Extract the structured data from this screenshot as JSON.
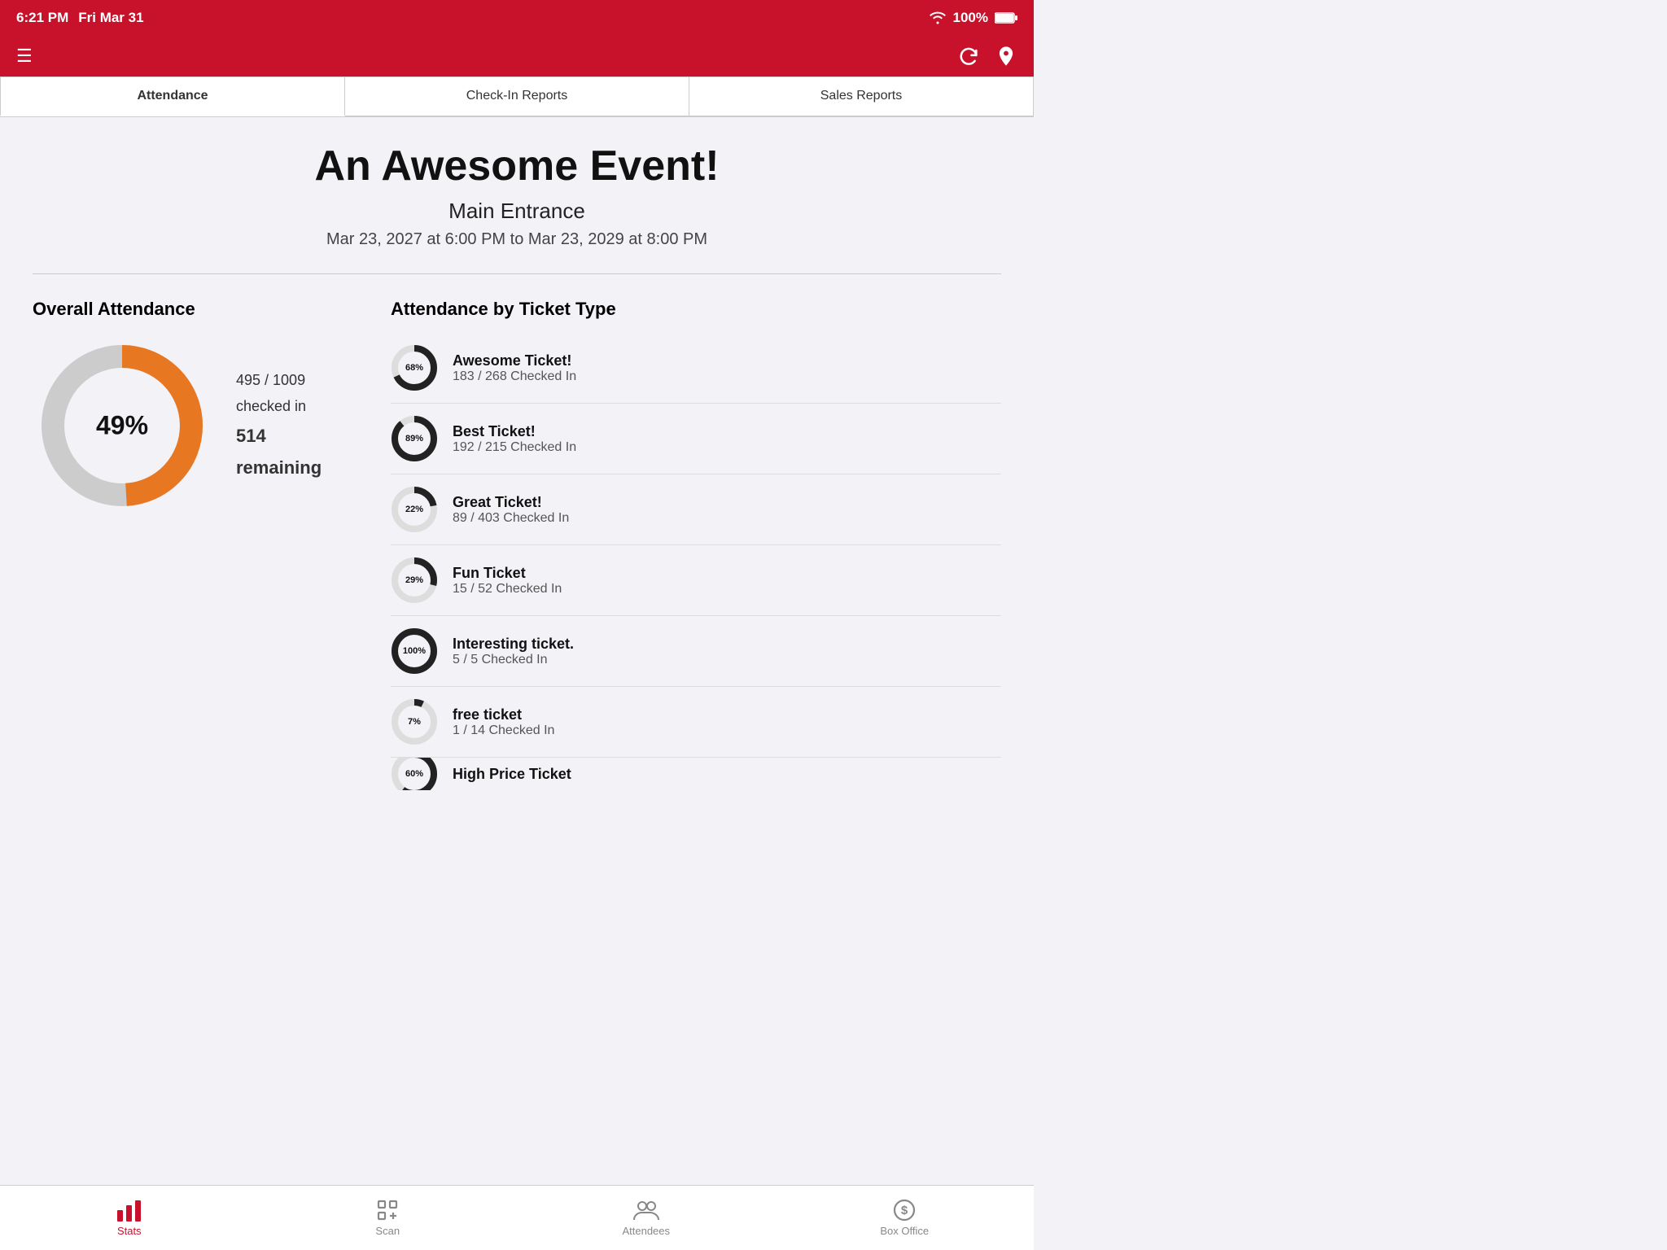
{
  "statusBar": {
    "time": "6:21 PM",
    "date": "Fri Mar 31",
    "battery": "100%"
  },
  "navBar": {
    "menuIcon": "☰",
    "refreshIcon": "↻",
    "personIcon": "🎫"
  },
  "tabs": {
    "items": [
      {
        "id": "attendance",
        "label": "Attendance",
        "active": true
      },
      {
        "id": "checkin-reports",
        "label": "Check-In Reports",
        "active": false
      },
      {
        "id": "sales-reports",
        "label": "Sales Reports",
        "active": false
      }
    ]
  },
  "event": {
    "title": "An Awesome Event!",
    "subtitle": "Main Entrance",
    "dateRange": "Mar 23, 2027 at 6:00 PM to Mar 23, 2029 at 8:00 PM"
  },
  "overallAttendance": {
    "heading": "Overall Attendance",
    "percent": 49,
    "percentLabel": "49%",
    "checkedIn": "495 / 1009 checked in",
    "remaining": "514 remaining",
    "filledColor": "#e87722",
    "emptyColor": "#cccccc"
  },
  "attendanceByTicket": {
    "heading": "Attendance by Ticket Type",
    "tickets": [
      {
        "name": "Awesome Ticket!",
        "detail": "183 / 268 Checked In",
        "percent": 68,
        "percentLabel": "68%"
      },
      {
        "name": "Best Ticket!",
        "detail": "192 / 215 Checked In",
        "percent": 89,
        "percentLabel": "89%"
      },
      {
        "name": "Great Ticket!",
        "detail": "89 / 403 Checked In",
        "percent": 22,
        "percentLabel": "22%"
      },
      {
        "name": "Fun Ticket",
        "detail": "15 / 52 Checked In",
        "percent": 29,
        "percentLabel": "29%"
      },
      {
        "name": "Interesting ticket.",
        "detail": "5 / 5 Checked In",
        "percent": 100,
        "percentLabel": "100%"
      },
      {
        "name": "free ticket",
        "detail": "1 / 14 Checked In",
        "percent": 7,
        "percentLabel": "7%"
      },
      {
        "name": "High Price Ticket",
        "detail": "",
        "percent": 60,
        "percentLabel": "60%"
      }
    ]
  },
  "bottomTabs": [
    {
      "id": "stats",
      "label": "Stats",
      "active": true,
      "icon": "📊"
    },
    {
      "id": "scan",
      "label": "Scan",
      "active": false,
      "icon": "⬜"
    },
    {
      "id": "attendees",
      "label": "Attendees",
      "active": false,
      "icon": "👥"
    },
    {
      "id": "box-office",
      "label": "Box Office",
      "active": false,
      "icon": "$"
    }
  ]
}
